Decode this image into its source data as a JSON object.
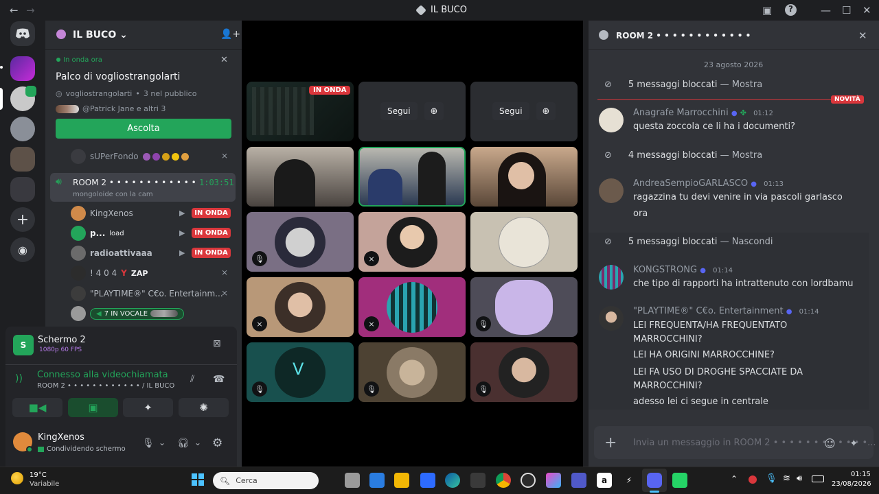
{
  "window": {
    "title": "IL BUCO"
  },
  "server": {
    "name": "IL BUCO"
  },
  "stage": {
    "status": "In onda ora",
    "title": "Palco di vogliostrangolarti",
    "host": "vogliostrangolarti",
    "audience": "3 nel pubblico",
    "members": "@Patrick Jane e altri 3",
    "listen_label": "Ascolta"
  },
  "members_above": {
    "name": "sUPerFondo"
  },
  "room": {
    "name": "ROOM 2 • • • • • • • • • • • •",
    "timer": "1:03:51",
    "subtitle": "mongoloide con la cam"
  },
  "room_members": [
    {
      "name": "KingXenos",
      "badge": "IN ONDA"
    },
    {
      "name": "p...",
      "extra": "load",
      "badge": "IN ONDA"
    },
    {
      "name": "radioattivaaa",
      "badge": "IN ONDA"
    },
    {
      "name": "! 4 0 4",
      "extra": "ZAP"
    },
    {
      "name": "\"PLAYTIME®\" C€o. Entertainm..."
    },
    {
      "name": "",
      "vc_label": "7 IN VOCALE"
    }
  ],
  "screen_share": {
    "title": "Schermo 2",
    "quality": "1080p 60 FPS"
  },
  "voice": {
    "status": "Connesso alla videochiamata",
    "location": "ROOM 2 • • • • • • • • • • • • / IL BUCO"
  },
  "user": {
    "name": "KingXenos",
    "status": "Condividendo schermo"
  },
  "grid": {
    "live_label": "IN ONDA",
    "follow_label": "Segui"
  },
  "chat": {
    "channel": "ROOM 2 • • • • • • • • • • • •",
    "date": "23 agosto 2026",
    "new_label": "NOVITÀ",
    "blocked": [
      {
        "text": "5 messaggi bloccati",
        "action": "— Mostra"
      },
      {
        "text": "4 messaggi bloccati",
        "action": "— Mostra"
      },
      {
        "text": "5 messaggi bloccati",
        "action": "— Nascondi"
      }
    ],
    "messages": [
      {
        "author": "Anagrafe Marrocchini",
        "time": "01:12",
        "lines": [
          "questa zoccola ce li ha i documenti?"
        ]
      },
      {
        "author": "AndreaSempioGARLASCO",
        "time": "01:13",
        "lines": [
          "ragazzina tu devi venire in via pascoli garlasco",
          "ora"
        ]
      },
      {
        "author": "KONGSTRONG",
        "time": "01:14",
        "lines": [
          "che tipo di rapporti ha intrattenuto con lordbamu"
        ]
      },
      {
        "author": "\"PLAYTIME®\" C€o. Entertainment",
        "time": "01:14",
        "lines": [
          "LEI FREQUENTA/HA FREQUENTATO MARROCCHINI?",
          "LEI HA ORIGINI MARROCCHINE?",
          "LEI FA USO DI DROGHE SPACCIATE DA MARROCCHINI?",
          "adesso lei ci segue in centrale"
        ]
      }
    ],
    "input_placeholder": "Invia un messaggio in ROOM 2 • • • • • • • • • • • •..."
  },
  "taskbar": {
    "weather_temp": "19°C",
    "weather_desc": "Variabile",
    "search_placeholder": "Cerca",
    "time": "01:15",
    "date": "23/08/2026"
  }
}
